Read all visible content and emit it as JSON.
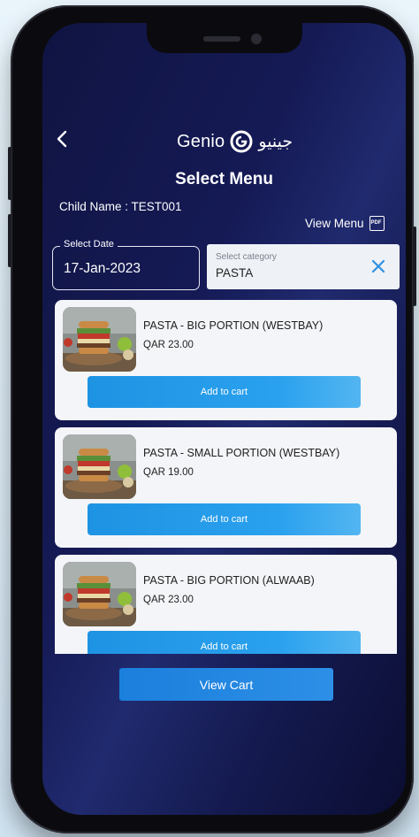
{
  "header": {
    "logo_text": "Genio",
    "logo_arabic": "جينيو",
    "page_title": "Select Menu"
  },
  "child": {
    "label": "Child Name : TEST001"
  },
  "view_menu": {
    "label": "View Menu",
    "icon_text": "PDF"
  },
  "date_field": {
    "label": "Select Date",
    "value": "17-Jan-2023"
  },
  "category_field": {
    "label": "Select category",
    "value": "PASTA"
  },
  "menu_items": [
    {
      "name": "PASTA - BIG PORTION (WESTBAY)",
      "price": "QAR 23.00",
      "button_label": "Add to cart"
    },
    {
      "name": "PASTA - SMALL PORTION (WESTBAY)",
      "price": "QAR 19.00",
      "button_label": "Add to cart"
    },
    {
      "name": "PASTA - BIG PORTION (ALWAAB)",
      "price": "QAR 23.00",
      "button_label": "Add to cart"
    }
  ],
  "view_cart": {
    "label": "View Cart"
  },
  "colors": {
    "accent": "#2196F3",
    "screen_bg": "#141a55",
    "card_bg": "#f4f5f8"
  }
}
